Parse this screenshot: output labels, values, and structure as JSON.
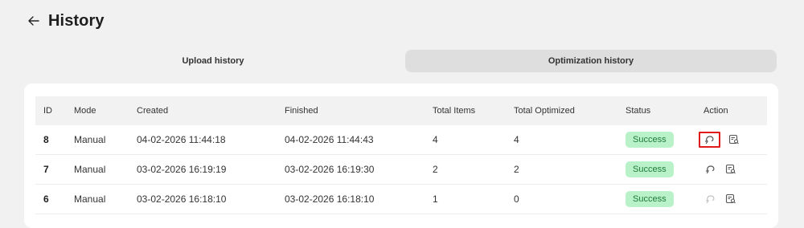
{
  "page": {
    "title": "History"
  },
  "tabs": [
    {
      "label": "Upload history",
      "active": false
    },
    {
      "label": "Optimization history",
      "active": true
    }
  ],
  "table": {
    "columns": [
      "ID",
      "Mode",
      "Created",
      "Finished",
      "Total Items",
      "Total Optimized",
      "Status",
      "Action"
    ],
    "rows": [
      {
        "id": "8",
        "mode": "Manual",
        "created": "04-02-2026 11:44:18",
        "finished": "04-02-2026 11:44:43",
        "total_items": "4",
        "total_optimized": "4",
        "status": "Success"
      },
      {
        "id": "7",
        "mode": "Manual",
        "created": "03-02-2026 16:19:19",
        "finished": "03-02-2026 16:19:30",
        "total_items": "2",
        "total_optimized": "2",
        "status": "Success"
      },
      {
        "id": "6",
        "mode": "Manual",
        "created": "03-02-2026 16:18:10",
        "finished": "03-02-2026 16:18:10",
        "total_items": "1",
        "total_optimized": "0",
        "status": "Success"
      }
    ]
  },
  "icons": {
    "back": "arrow-left-icon",
    "revert": "undo-icon",
    "details": "view-details-icon"
  },
  "colors": {
    "success_bg": "#b9f2c9",
    "success_text": "#1e7a3a",
    "highlight": "#e01b1b"
  }
}
